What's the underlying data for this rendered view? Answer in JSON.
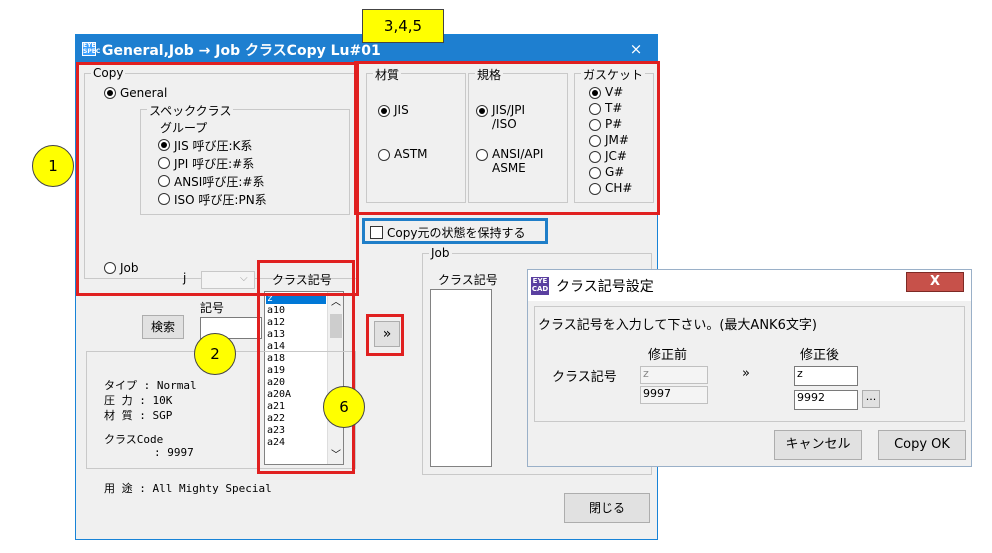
{
  "annotations": {
    "label_345": "3,4,5",
    "circle_1": "1",
    "circle_2": "2",
    "circle_6": "6"
  },
  "window": {
    "title": "General,Job → Job クラスCopy   Lu#01",
    "close": "×",
    "copy_group": {
      "label": "Copy",
      "general_radio": "General",
      "spec_class_label": "スペッククラス",
      "group_label": "グループ",
      "groups": [
        "JIS  呼び圧:K系",
        "JPI  呼び圧:#系",
        "ANSI呼び圧:#系",
        "ISO  呼び圧:PN系"
      ],
      "job_radio": "Job",
      "j_label": "j"
    },
    "material_group": {
      "label": "材質",
      "options": [
        "JIS",
        "ASTM"
      ]
    },
    "standard_group": {
      "label": "規格",
      "options": [
        "JIS/JPI\n/ISO",
        "ANSI/API\nASME"
      ]
    },
    "gasket_group": {
      "label": "ガスケット",
      "options": [
        "V#",
        "T#",
        "P#",
        "JM#",
        "JC#",
        "G#",
        "CH#"
      ]
    },
    "keep_checkbox": "Copy元の状態を保持する",
    "kigou_label": "記号",
    "search_button": "検索",
    "class_list": {
      "header": "クラス記号",
      "items": [
        "z",
        "a10",
        "a12",
        "a13",
        "a14",
        "a18",
        "a19",
        "a20",
        "a20A",
        "a21",
        "a22",
        "a23",
        "a24"
      ]
    },
    "info": {
      "type": "タイプ : Normal",
      "pressure": "圧  力 : 10K",
      "material": "材  質 : SGP",
      "class_code": "クラスCode",
      "class_code_value": ": 9997"
    },
    "usage": "用  途 : All Mighty Special",
    "arrow_button": "»",
    "job_group": {
      "label": "Job",
      "header": "クラス記号"
    },
    "close_button": "閉じる"
  },
  "dialog": {
    "title": "クラス記号設定",
    "close": "X",
    "prompt": "クラス記号を入力して下さい。(最大ANK6文字)",
    "before_label": "修正前",
    "after_label": "修正後",
    "row_label": "クラス記号",
    "arrow": "»",
    "before_value": "z",
    "before_code": "9997",
    "after_value": "z",
    "after_code": "9992",
    "browse_button": "...",
    "cancel_button": "キャンセル",
    "ok_button": "Copy OK"
  }
}
